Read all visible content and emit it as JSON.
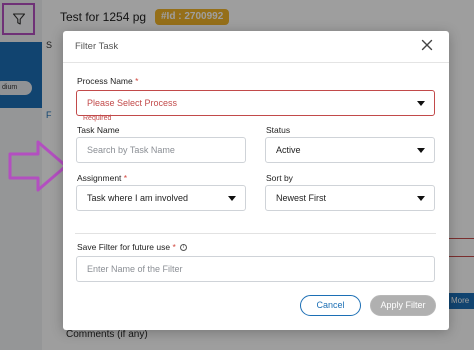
{
  "background": {
    "title": "Test for 1254 pg",
    "id_badge": "#Id : 2700992",
    "pill_text": "dium",
    "s_label": "S",
    "f_label": "F",
    "more_label": "More",
    "bottom_label": "Comments (if any)"
  },
  "modal": {
    "title": "Filter Task",
    "close_icon": "close-icon",
    "process_name": {
      "label": "Process Name",
      "required_mark": "*",
      "placeholder": "Please Select Process",
      "error": "Required"
    },
    "task_name": {
      "label": "Task Name",
      "placeholder": "Search by Task Name"
    },
    "status": {
      "label": "Status",
      "value": "Active"
    },
    "assignment": {
      "label": "Assignment",
      "required_mark": "*",
      "value": "Task where I am involved"
    },
    "sort_by": {
      "label": "Sort by",
      "value": "Newest First"
    },
    "save_filter": {
      "label": "Save Filter for future use",
      "required_mark": "*",
      "placeholder": "Enter Name of the Filter"
    },
    "cancel_label": "Cancel",
    "apply_label": "Apply Filter"
  },
  "colors": {
    "accent": "#1c6fb5",
    "error": "#c24a4a",
    "annotation": "#b34fc0",
    "badge": "#f0b429"
  }
}
